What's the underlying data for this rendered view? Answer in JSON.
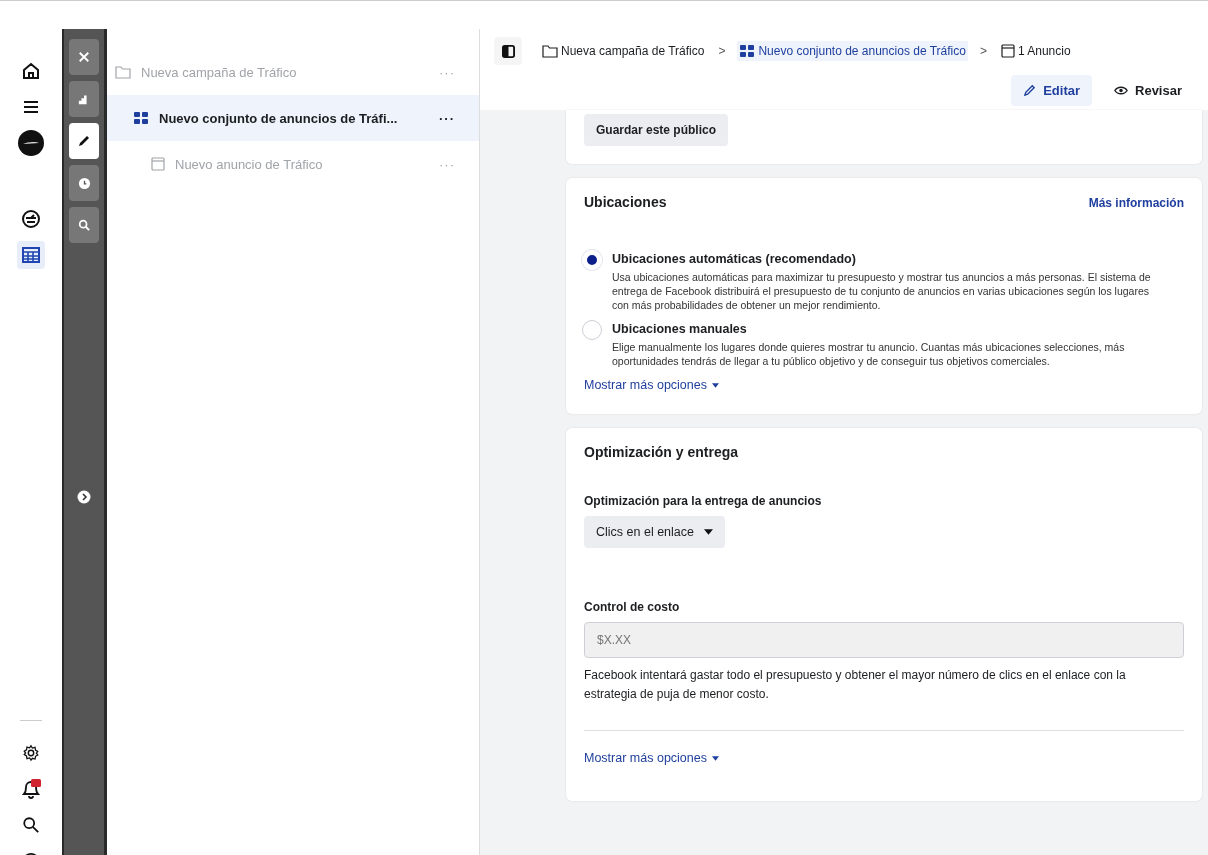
{
  "nav_rail": {
    "items": [
      {
        "kind": "home",
        "selected": false
      },
      {
        "kind": "menu",
        "selected": false
      },
      {
        "kind": "avatar",
        "selected": false
      },
      {
        "kind": "gauge",
        "selected": false
      },
      {
        "kind": "table",
        "selected": true
      }
    ],
    "bottom_items": [
      {
        "kind": "settings"
      },
      {
        "kind": "notifications"
      },
      {
        "kind": "search"
      },
      {
        "kind": "help"
      }
    ]
  },
  "tool_rail": {
    "items": [
      {
        "kind": "close",
        "selected": false
      },
      {
        "kind": "chart",
        "selected": false
      },
      {
        "kind": "edit",
        "selected": true
      },
      {
        "kind": "history",
        "selected": false
      },
      {
        "kind": "zoom",
        "selected": false
      }
    ],
    "expand": {
      "kind": "expand"
    }
  },
  "tree": {
    "items": [
      {
        "kind": "campaign",
        "label": "Nueva campaña de Tráfico",
        "selected": false,
        "disabled": true,
        "more": "···",
        "children": [
          {
            "kind": "adset",
            "label": "Nuevo conjunto de anuncios de Tráfi...",
            "selected": true,
            "disabled": false,
            "more": "···",
            "children": [
              {
                "kind": "ad",
                "label": "Nuevo anuncio de Tráfico",
                "selected": false,
                "disabled": true,
                "more": "···"
              }
            ]
          }
        ]
      }
    ]
  },
  "breadcrumb": [
    {
      "kind": "campaign",
      "label": "Nueva campaña de Tráfico",
      "selected": false
    },
    {
      "kind": "adset",
      "label": "Nuevo conjunto de anuncios de Tráfico",
      "selected": true
    },
    {
      "kind": "ad",
      "label": "1 Anuncio",
      "selected": false
    }
  ],
  "separator": ">",
  "mode_buttons": [
    {
      "kind": "edit",
      "label": "Editar",
      "selected": true
    },
    {
      "kind": "review",
      "label": "Revisar",
      "selected": false
    }
  ],
  "audience_card": {
    "save_button": "Guardar este público"
  },
  "placements": {
    "title": "Ubicaciones",
    "link": "Más información",
    "options": [
      {
        "label": "Ubicaciones automáticas (recomendado)",
        "description": "Usa ubicaciones automáticas para maximizar tu presupuesto y mostrar tus anuncios a más personas. El sistema de entrega de Facebook distribuirá el presupuesto de tu conjunto de anuncios en varias ubicaciones según los lugares con más probabilidades de obtener un mejor rendimiento.",
        "selected": true
      },
      {
        "label": "Ubicaciones manuales",
        "description": "Elige manualmente los lugares donde quieres mostrar tu anuncio. Cuantas más ubicaciones selecciones, más oportunidades tendrás de llegar a tu público objetivo y de conseguir tus objetivos comerciales.",
        "selected": false
      }
    ],
    "more": "Mostrar más opciones"
  },
  "delivery": {
    "title": "Optimización y entrega",
    "optimization_label": "Optimización para la entrega de anuncios",
    "optimization_value": "Clics en el enlace",
    "cost_label": "Control de costo",
    "cost_placeholder": "$X.XX",
    "cost_disabled": true,
    "help": "Facebook intentará gastar todo el presupuesto y obtener el mayor número de clics en el enlace con la estrategia de puja de menor costo.",
    "more": "Mostrar más opciones"
  }
}
